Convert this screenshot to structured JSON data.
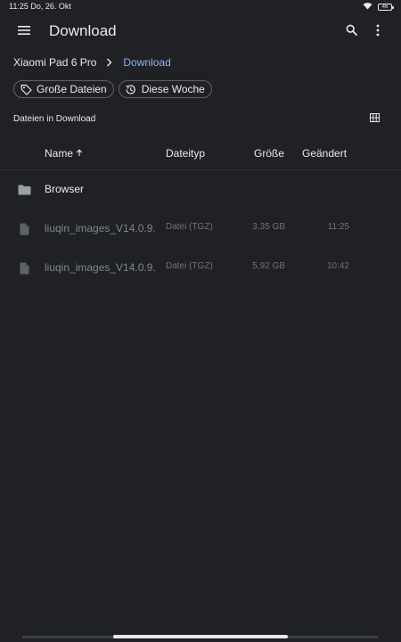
{
  "status_bar": {
    "time_date": "11:25 Do, 26. Okt",
    "battery": "46",
    "icons": [
      "wifi-icon",
      "battery-icon"
    ]
  },
  "app_bar": {
    "title": "Download",
    "icons": [
      "menu-icon",
      "search-icon",
      "more-vert-icon"
    ]
  },
  "breadcrumb": {
    "items": [
      "Xiaomi Pad 6 Pro",
      "Download"
    ],
    "current_color": "#8ab4f8"
  },
  "chips": [
    {
      "label": "Große Dateien",
      "icon": "tag-icon"
    },
    {
      "label": "Diese Woche",
      "icon": "history-icon"
    }
  ],
  "section": {
    "title": "Dateien in Download",
    "view_toggle_icon": "grid-view-icon"
  },
  "table": {
    "columns": {
      "name": "Name",
      "name_sort_icon": "arrow-up-icon",
      "type": "Dateityp",
      "size": "Größe",
      "modified": "Geändert"
    },
    "rows": [
      {
        "kind": "folder",
        "icon": "folder-icon",
        "name": "Browser",
        "type": "",
        "size": "",
        "modified": ""
      },
      {
        "kind": "file",
        "icon": "file-icon",
        "name": "liuqin_images_V14.0.9.",
        "type": "Datei (TGZ)",
        "size": "3,35 GB",
        "modified": "11:25"
      },
      {
        "kind": "file",
        "icon": "file-icon",
        "name": "liuqin_images_V14.0.9.",
        "type": "Datei (TGZ)",
        "size": "5,92 GB",
        "modified": "10:42"
      }
    ]
  },
  "colors": {
    "background": "#202124",
    "text_primary": "#e8eaed",
    "text_dim": "#80868b",
    "accent": "#8ab4f8",
    "chip_border": "#5f6368"
  }
}
